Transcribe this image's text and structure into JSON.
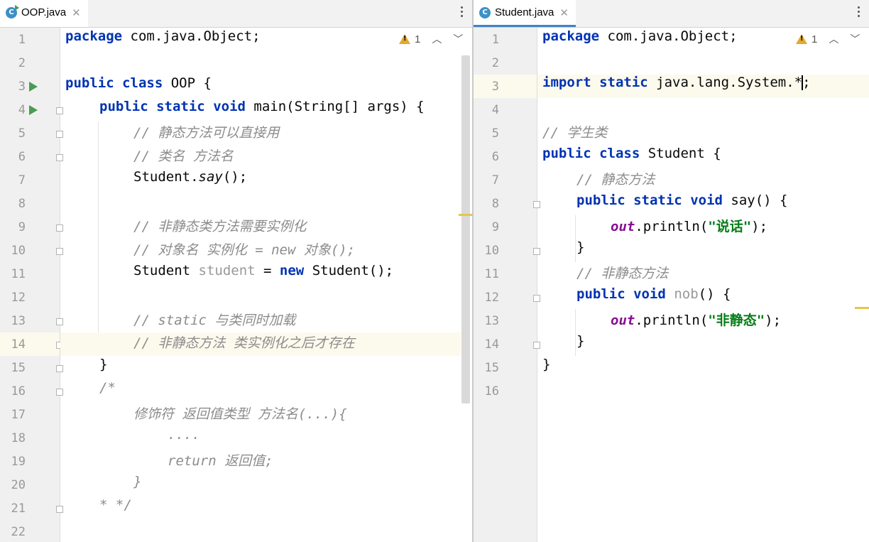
{
  "left": {
    "tab": {
      "label": "OOP.java",
      "close": "✕",
      "icon": "C"
    },
    "inspection": {
      "count": "1",
      "up": "︿",
      "down": "﹀"
    },
    "line_numbers": [
      "1",
      "2",
      "3",
      "4",
      "5",
      "6",
      "7",
      "8",
      "9",
      "10",
      "11",
      "12",
      "13",
      "14",
      "15",
      "16",
      "17",
      "18",
      "19",
      "20",
      "21",
      "22"
    ],
    "code": {
      "l1_a": "package",
      "l1_b": " com.java.Object;",
      "l3_a": "public",
      "l3_b": "class",
      "l3_c": " OOP {",
      "l4_a": "public",
      "l4_b": "static",
      "l4_c": "void",
      "l4_d": " main(String[] args) {",
      "l5": "// 静态方法可以直接用",
      "l6": "// 类名 方法名",
      "l7_a": "Student.",
      "l7_b": "say",
      "l7_c": "();",
      "l9": "// 非静态类方法需要实例化",
      "l10": "// 对象名 实例化 = new 对象();",
      "l11_a": "Student ",
      "l11_b": "student",
      "l11_c": " = ",
      "l11_d": "new",
      "l11_e": " Student();",
      "l13": "// static 与类同时加载",
      "l14": "// 非静态方法 类实例化之后才存在",
      "l15": "}",
      "l16": "/*",
      "l17": "修饰符 返回值类型 方法名(...){",
      "l18": "....",
      "l19": "return 返回值;",
      "l20": "}",
      "l21": "* */"
    }
  },
  "right": {
    "tab": {
      "label": "Student.java",
      "close": "✕",
      "icon": "C"
    },
    "inspection": {
      "count": "1",
      "up": "︿",
      "down": "﹀"
    },
    "line_numbers": [
      "1",
      "2",
      "3",
      "4",
      "5",
      "6",
      "7",
      "8",
      "9",
      "10",
      "11",
      "12",
      "13",
      "14",
      "15",
      "16"
    ],
    "code": {
      "l1_a": "package",
      "l1_b": " com.java.Object;",
      "l3_a": "import",
      "l3_b": "static",
      "l3_c": " java.lang.System.*",
      "l3_d": ";",
      "l5": "// 学生类",
      "l6_a": "public",
      "l6_b": "class",
      "l6_c": " Student {",
      "l7": "// 静态方法",
      "l8_a": "public",
      "l8_b": "static",
      "l8_c": "void",
      "l8_d": " say() {",
      "l9_a": "out",
      "l9_b": ".println(",
      "l9_c": "\"说话\"",
      "l9_d": ");",
      "l10": "}",
      "l11": "// 非静态方法",
      "l12_a": "public",
      "l12_b": "void",
      "l12_c": "nob",
      "l12_d": "() {",
      "l13_a": "out",
      "l13_b": ".println(",
      "l13_c": "\"非静态\"",
      "l13_d": ");",
      "l14": "}",
      "l15": "}"
    }
  },
  "colors": {
    "keyword": "#0033b3",
    "comment": "#8c8c8c",
    "string": "#067d17",
    "field": "#871094",
    "current_line": "#fcfaed",
    "tab_underline": "#4083c9"
  }
}
